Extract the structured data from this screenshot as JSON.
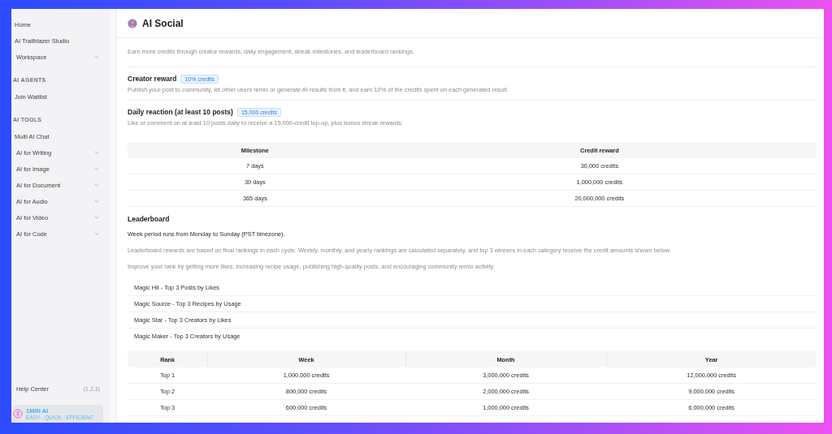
{
  "sidebar": {
    "sections": [
      {
        "items": [
          {
            "label": "Home",
            "kind": "link"
          },
          {
            "label": "AI Trailblazer Studio",
            "kind": "link"
          },
          {
            "label": "Workspace",
            "kind": "group",
            "expanded": false
          }
        ]
      },
      {
        "heading": "AI AGENTS",
        "items": [
          {
            "label": "Join Waitlist",
            "kind": "link"
          }
        ]
      },
      {
        "heading": "AI TOOLS",
        "items": [
          {
            "label": "Multi AI Chat",
            "kind": "link"
          },
          {
            "label": "AI for Writing",
            "kind": "group",
            "expanded": false
          },
          {
            "label": "AI for Image",
            "kind": "group",
            "expanded": false
          },
          {
            "label": "AI for Document",
            "kind": "group",
            "expanded": false
          },
          {
            "label": "AI for Audio",
            "kind": "group",
            "expanded": false
          },
          {
            "label": "AI for Video",
            "kind": "group",
            "expanded": false
          },
          {
            "label": "AI for Code",
            "kind": "group",
            "expanded": false
          }
        ]
      }
    ],
    "help": {
      "label": "Help Center",
      "version": "(1.2.3)"
    },
    "brand": {
      "name": "1MIN AI",
      "tagline": "EASY - QUICK - EFFICIENT"
    }
  },
  "page": {
    "title": "AI Social",
    "intro": "Earn more credits through creator rewards, daily engagement, streak milestones, and leaderboard rankings.",
    "rewards": [
      {
        "title": "Creator reward",
        "badge": "10% credits",
        "description": "Publish your post to community, let other users remix or generate AI results from it, and earn 10% of the credits spent on each generated result."
      },
      {
        "title": "Daily reaction (at least 10 posts)",
        "badge": "15,000 credits",
        "description": "Like or comment on at least 10 posts daily to receive a 15,000-credit top-up, plus bonus streak rewards."
      }
    ],
    "milestones": {
      "columns": [
        "Milestone",
        "Credit reward"
      ],
      "rows": [
        [
          "7 days",
          "30,000 credits"
        ],
        [
          "30 days",
          "1,000,000 credits"
        ],
        [
          "365 days",
          "20,000,000 credits"
        ]
      ]
    },
    "leaderboard": {
      "title": "Leaderboard",
      "period_note": "Week period runs from Monday to Sunday (PST timezone).",
      "notes": [
        "Leaderboard rewards are based on final rankings in each cycle. Weekly, monthly, and yearly rankings are calculated separately, and top 3 winners in each category receive the credit amounts shown below.",
        "Improve your rank by getting more likes, increasing recipe usage, publishing high-quality posts, and encouraging community remix activity."
      ],
      "categories": [
        "Magic Hit - Top 3 Posts by Likes",
        "Magic Source - Top 3 Recipes by Usage",
        "Magic Star - Top 3 Creators by Likes",
        "Magic Maker - Top 3 Creators by Usage"
      ],
      "table": {
        "columns": [
          "Rank",
          "Week",
          "Month",
          "Year"
        ],
        "rows": [
          [
            "Top 1",
            "1,000,000 credits",
            "3,000,000 credits",
            "12,000,000 credits"
          ],
          [
            "Top 2",
            "800,000 credits",
            "2,000,000 credits",
            "9,000,000 credits"
          ],
          [
            "Top 3",
            "600,000 credits",
            "1,000,000 credits",
            "6,000,000 credits"
          ]
        ]
      }
    }
  }
}
